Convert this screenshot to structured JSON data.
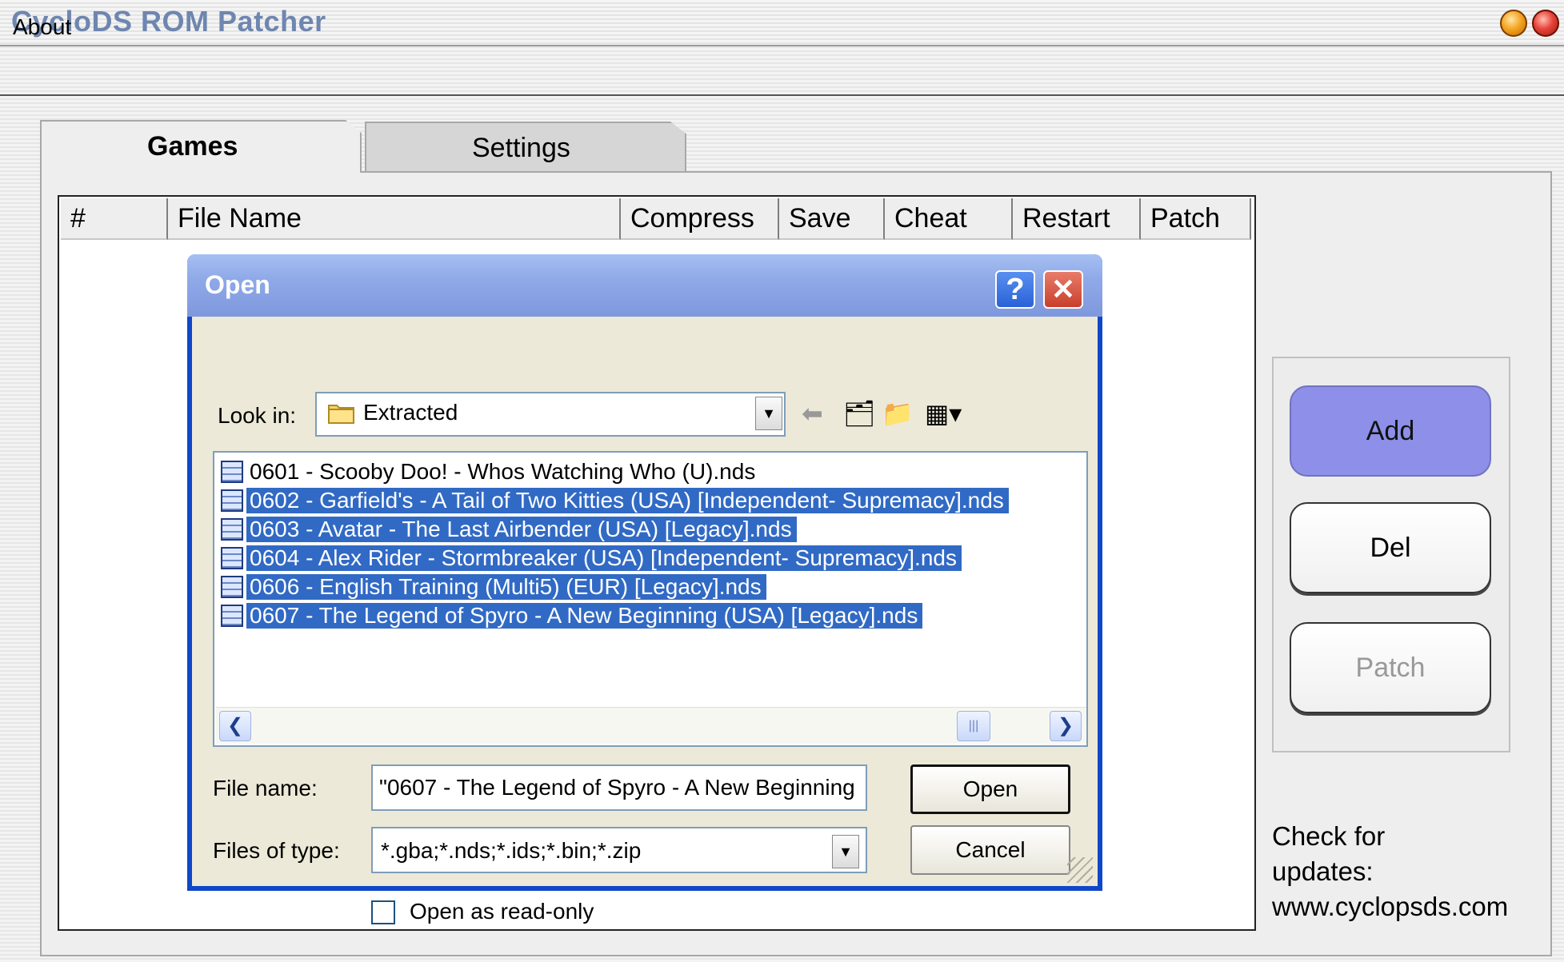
{
  "app": {
    "title": "CycloDS ROM Patcher"
  },
  "menu": {
    "about": "About"
  },
  "tabs": {
    "games": "Games",
    "settings": "Settings"
  },
  "list_columns": [
    "#",
    "File Name",
    "Compress",
    "Save",
    "Cheat",
    "Restart",
    "Patch"
  ],
  "side_buttons": {
    "add": "Add",
    "del": "Del",
    "patch": "Patch"
  },
  "updates": {
    "line1": "Check for",
    "line2": "updates:",
    "url": "www.cyclopsds.com"
  },
  "dialog": {
    "title": "Open",
    "help_glyph": "?",
    "close_glyph": "✕",
    "look_in_label": "Look in:",
    "look_in_value": "Extracted",
    "files": [
      {
        "name": "0601 - Scooby Doo! - Whos Watching Who (U).nds",
        "selected": false
      },
      {
        "name": "0602 - Garfield's - A Tail of Two Kitties (USA) [Independent- Supremacy].nds",
        "selected": true
      },
      {
        "name": "0603 - Avatar - The Last Airbender (USA) [Legacy].nds",
        "selected": true
      },
      {
        "name": "0604 - Alex Rider - Stormbreaker (USA) [Independent- Supremacy].nds",
        "selected": true
      },
      {
        "name": "0606 - English Training (Multi5) (EUR) [Legacy].nds",
        "selected": true
      },
      {
        "name": "0607 - The Legend of Spyro - A New Beginning (USA) [Legacy].nds",
        "selected": true
      }
    ],
    "file_name_label": "File name:",
    "file_name_value": "\"0607 - The Legend of Spyro - A New Beginning",
    "files_of_type_label": "Files of type:",
    "files_of_type_value": "*.gba;*.nds;*.ids;*.bin;*.zip",
    "open_button": "Open",
    "cancel_button": "Cancel",
    "read_only_label": "Open as read-only",
    "read_only_checked": false
  },
  "colors": {
    "selection": "#316ac5",
    "dialog_frame": "#0f47c8",
    "add_button": "#8d8fe8"
  }
}
